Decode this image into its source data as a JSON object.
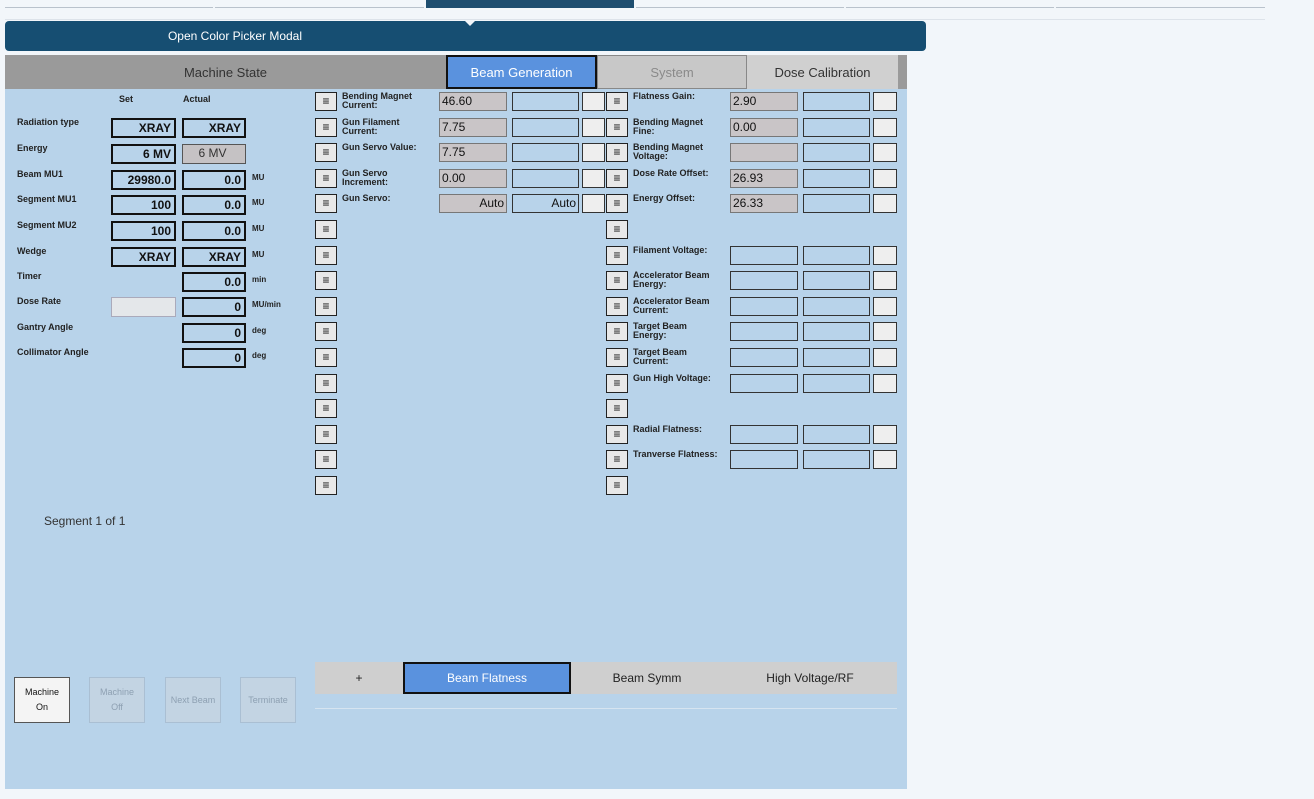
{
  "modal_button": {
    "label": "Open Color Picker Modal"
  },
  "tabs": [
    {
      "label": "Machine State"
    },
    {
      "label": "Beam Generation"
    },
    {
      "label": "System"
    },
    {
      "label": "Dose Calibration"
    }
  ],
  "machine_state": {
    "col_set": "Set",
    "col_actual": "Actual",
    "rows": [
      {
        "label": "Radiation type",
        "set": "XRAY",
        "actual": "XRAY",
        "unit": ""
      },
      {
        "label": "Energy",
        "set": "6 MV",
        "actual": "6 MV",
        "unit": ""
      },
      {
        "label": "Beam MU1",
        "set": "29980.0",
        "actual": "0.0",
        "unit": "MU"
      },
      {
        "label": "Segment MU1",
        "set": "100",
        "actual": "0.0",
        "unit": "MU"
      },
      {
        "label": "Segment MU2",
        "set": "100",
        "actual": "0.0",
        "unit": "MU"
      },
      {
        "label": "Wedge",
        "set": "XRAY",
        "actual": "XRAY",
        "unit": "MU"
      },
      {
        "label": "Timer",
        "set": "",
        "actual": "0.0",
        "unit": "min"
      },
      {
        "label": "Dose Rate",
        "set": "",
        "actual": "0",
        "unit": "MU/min"
      },
      {
        "label": "Gantry Angle",
        "set": "",
        "actual": "0",
        "unit": "deg"
      },
      {
        "label": "Collimator Angle",
        "set": "",
        "actual": "0",
        "unit": "deg"
      }
    ],
    "segment_text": "Segment 1 of 1"
  },
  "controls": [
    {
      "label1": "Machine",
      "label2": "On"
    },
    {
      "label1": "Machine",
      "label2": "Off"
    },
    {
      "label1": "Next Beam",
      "label2": ""
    },
    {
      "label1": "Terminate",
      "label2": ""
    }
  ],
  "menu_glyph": "≡",
  "beam_left": [
    {
      "label1": "Bending Magnet",
      "label2": "Current:",
      "value": "46.60",
      "set": ""
    },
    {
      "label1": "Gun Filament",
      "label2": "Current:",
      "value": "7.75",
      "set": ""
    },
    {
      "label1": "Gun Servo Value:",
      "label2": "",
      "value": "7.75",
      "set": ""
    },
    {
      "label1": "Gun Servo",
      "label2": "Increment:",
      "value": "0.00",
      "set": ""
    },
    {
      "label1": "Gun Servo:",
      "label2": "",
      "value": "Auto",
      "set": "Auto"
    }
  ],
  "beam_right": [
    {
      "label1": "Flatness Gain:",
      "label2": "",
      "value": "2.90"
    },
    {
      "label1": "Bending Magnet",
      "label2": "Fine:",
      "value": "0.00"
    },
    {
      "label1": "Bending Magnet",
      "label2": "Voltage:",
      "value": ""
    },
    {
      "label1": "Dose Rate Offset:",
      "label2": "",
      "value": "26.93"
    },
    {
      "label1": "Energy Offset:",
      "label2": "",
      "value": "26.33"
    },
    {
      "label1": "",
      "label2": "",
      "value": ""
    },
    {
      "label1": "Filament Voltage:",
      "label2": "",
      "value": ""
    },
    {
      "label1": "Accelerator Beam",
      "label2": "Energy:",
      "value": ""
    },
    {
      "label1": "Accelerator Beam",
      "label2": "Current:",
      "value": ""
    },
    {
      "label1": "Target Beam",
      "label2": "Energy:",
      "value": ""
    },
    {
      "label1": "Target Beam",
      "label2": "Current:",
      "value": ""
    },
    {
      "label1": "Gun High Voltage:",
      "label2": "",
      "value": ""
    },
    {
      "label1": "",
      "label2": "",
      "value": ""
    },
    {
      "label1": "Radial Flatness:",
      "label2": "",
      "value": ""
    },
    {
      "label1": "Tranverse Flatness:",
      "label2": "",
      "value": ""
    },
    {
      "label1": "",
      "label2": "",
      "value": ""
    }
  ],
  "bottom_tabs": [
    {
      "label": "+"
    },
    {
      "label": "Beam Flatness"
    },
    {
      "label": "Beam Symm"
    },
    {
      "label": "High Voltage/RF"
    }
  ]
}
